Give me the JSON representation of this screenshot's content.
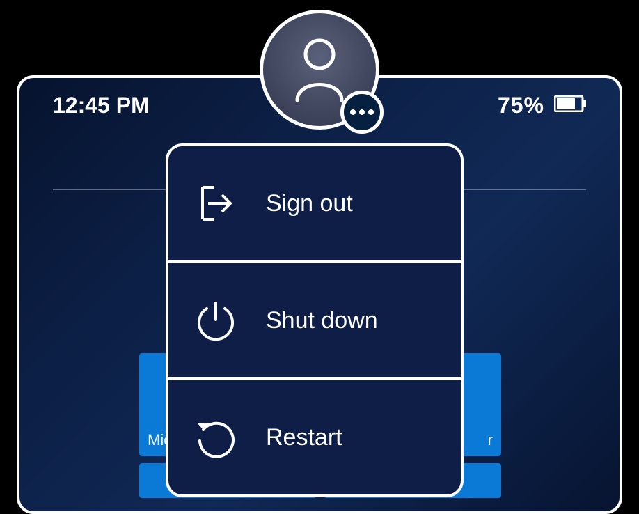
{
  "status": {
    "time": "12:45 PM",
    "battery_pct": "75%"
  },
  "tiles": {
    "row1": [
      "Mic",
      "r"
    ]
  },
  "menu": {
    "items": [
      {
        "icon": "sign-out-icon",
        "label": "Sign out"
      },
      {
        "icon": "power-icon",
        "label": "Shut down"
      },
      {
        "icon": "restart-icon",
        "label": "Restart"
      }
    ]
  }
}
